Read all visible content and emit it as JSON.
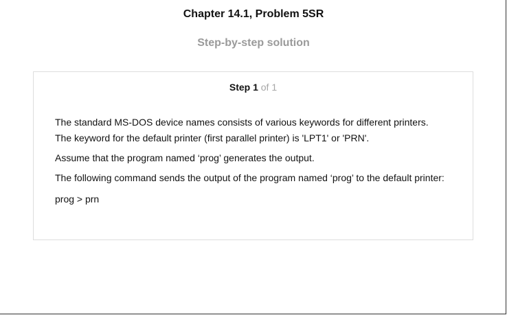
{
  "header": {
    "chapter_title": "Chapter 14.1, Problem 5SR",
    "subtitle": "Step-by-step solution"
  },
  "step": {
    "label": "Step 1",
    "of_label": "of 1",
    "paragraphs": [
      "The standard MS-DOS device names consists of various keywords for different printers.",
      "The keyword for the default printer (first parallel printer) is 'LPT1' or 'PRN'.",
      "Assume that the program named ‘prog’ generates the output.",
      "The following command sends the output of the program named ‘prog’ to the default printer:",
      "prog > prn"
    ]
  }
}
